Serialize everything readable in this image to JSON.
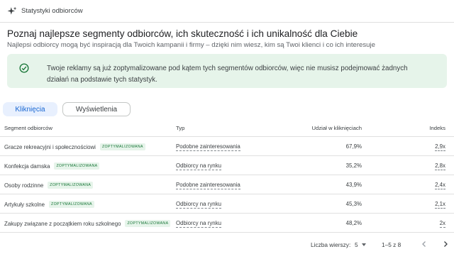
{
  "header": {
    "title": "Statystyki odbiorców",
    "icon": "sparkle-icon"
  },
  "intro": {
    "title": "Poznaj najlepsze segmenty odbiorców, ich skuteczność i ich unikalność dla Ciebie",
    "subtitle": "Najlepsi odbiorcy mogą być inspiracją dla Twoich kampanii i firmy – dzięki nim wiesz, kim są Twoi klienci i co ich interesuje"
  },
  "notice": {
    "icon": "check-circle-icon",
    "text": "Twoje reklamy są już zoptymalizowane pod kątem tych segmentów odbiorców, więc nie musisz podejmować żadnych działań na podstawie tych statystyk.",
    "background": "#e6f4ea"
  },
  "tabs": [
    {
      "label": "Kliknięcia",
      "active": true
    },
    {
      "label": "Wyświetlenia",
      "active": false
    }
  ],
  "table": {
    "columns": {
      "segment": "Segment odbiorców",
      "type": "Typ",
      "share": "Udział w kliknięciach",
      "index": "Indeks"
    },
    "rows": [
      {
        "segment": "Gracze rekreacyjni i społecznościowi",
        "badge": "ZOPTYMALIZOWANA",
        "type": "Podobne zainteresowania",
        "share": "67,9%",
        "index": "2,9x"
      },
      {
        "segment": "Konfekcja damska",
        "badge": "ZOPTYMALIZOWANA",
        "type": "Odbiorcy na rynku",
        "share": "35,2%",
        "index": "2,8x"
      },
      {
        "segment": "Osoby rodzinne",
        "badge": "ZOPTYMALIZOWANA",
        "type": "Podobne zainteresowania",
        "share": "43,9%",
        "index": "2,4x"
      },
      {
        "segment": "Artykuły szkolne",
        "badge": "ZOPTYMALIZOWANA",
        "type": "Odbiorcy na rynku",
        "share": "45,3%",
        "index": "2,1x"
      },
      {
        "segment": "Zakupy związane z początkiem roku szkolnego",
        "badge": "ZOPTYMALIZOWANA",
        "type": "Odbiorcy na rynku",
        "share": "48,2%",
        "index": "2x"
      }
    ]
  },
  "pagination": {
    "rows_label": "Liczba wierszy:",
    "rows_value": "5",
    "range": "1–5 z 8"
  },
  "colors": {
    "accent": "#1967d2",
    "badge_green": "#137333",
    "tab_active_bg": "#e8f0fe"
  }
}
